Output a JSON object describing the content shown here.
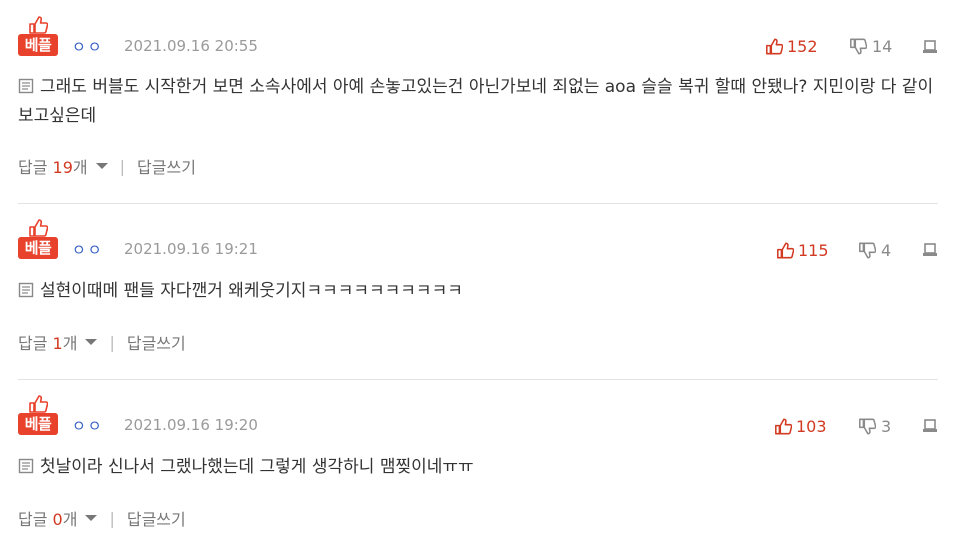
{
  "comments": [
    {
      "badge": "베플",
      "user": "ㅇㅇ",
      "date": "2021.09.16 20:55",
      "likes": "152",
      "dislikes": "14",
      "text": "그래도 버블도 시작한거 보면 소속사에서 아예 손놓고있는건 아닌가보네 죄없는 aoa 슬슬 복귀 할때 안됐나? 지민이랑 다 같이 보고싶은데",
      "reply_label": "답글",
      "reply_count": "19",
      "reply_unit": "개",
      "write_reply": "답글쓰기"
    },
    {
      "badge": "베플",
      "user": "ㅇㅇ",
      "date": "2021.09.16 19:21",
      "likes": "115",
      "dislikes": "4",
      "text": "설현이때메 팬들 자다깬거 왜케웃기지ㅋㅋㅋㅋㅋㅋㅋㅋㅋㅋ",
      "reply_label": "답글",
      "reply_count": "1",
      "reply_unit": "개",
      "write_reply": "답글쓰기"
    },
    {
      "badge": "베플",
      "user": "ㅇㅇ",
      "date": "2021.09.16 19:20",
      "likes": "103",
      "dislikes": "3",
      "text": "첫날이라 신나서 그랬나했는데 그렇게 생각하니 맴찢이네ㅠㅠ",
      "reply_label": "답글",
      "reply_count": "0",
      "reply_unit": "개",
      "write_reply": "답글쓰기"
    }
  ],
  "colors": {
    "badge": "#e8412c",
    "like": "#d23a22",
    "user": "#3a62c8",
    "date": "#9a9a9a"
  },
  "icons": {
    "like": "thumbs-up-icon",
    "dislike": "thumbs-down-icon",
    "report": "report-icon",
    "doc": "document-icon",
    "caret": "caret-down-icon"
  }
}
